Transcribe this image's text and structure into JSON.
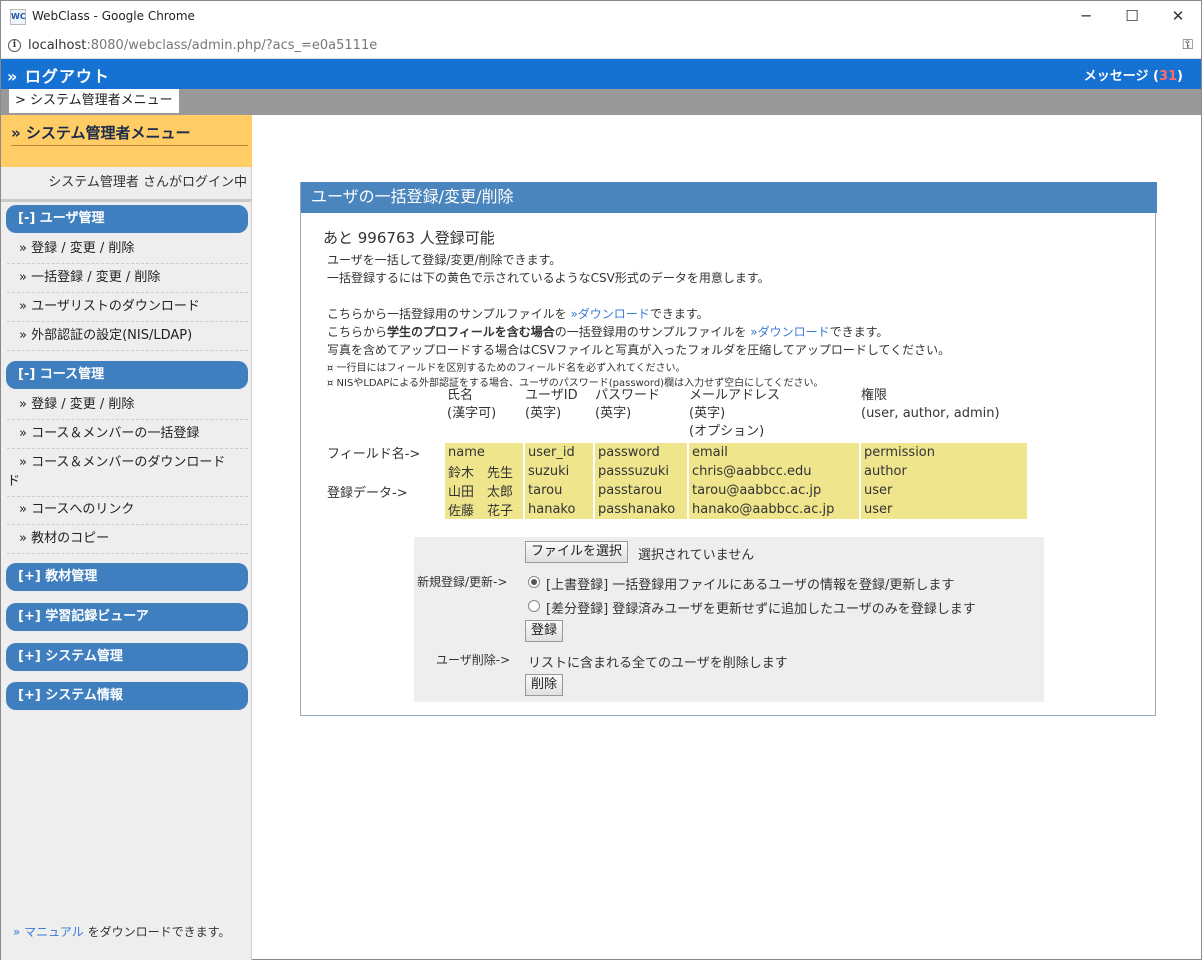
{
  "window": {
    "title": "WebClass - Google Chrome",
    "favicon_text": "WC",
    "minimize": "─",
    "maximize": "☐",
    "close": "✕"
  },
  "address": {
    "host": "localhost",
    "rest": ":8080/webclass/admin.php/?acs_=e0a5111e"
  },
  "topbar": {
    "logout": "» ログアウト",
    "messages_label": "メッセージ (",
    "messages_count": "31",
    "messages_close": ")"
  },
  "breadcrumb": "> システム管理者メニュー",
  "sidebar": {
    "heading": "» システム管理者メニュー",
    "login_user": "システム管理者 さんがログイン中",
    "sections": [
      {
        "label": "[-] ユーザ管理"
      },
      {
        "label": "[-] コース管理"
      },
      {
        "label": "[+] 教材管理"
      },
      {
        "label": "[+] 学習記録ビューア"
      },
      {
        "label": "[+] システム管理"
      },
      {
        "label": "[+] システム情報"
      }
    ],
    "user_items": [
      "» 登録 / 変更 / 削除",
      "» 一括登録 / 変更 / 削除",
      "» ユーザリストのダウンロード",
      "» 外部認証の設定(NIS/LDAP)"
    ],
    "course_items": [
      "» 登録 / 変更 / 削除",
      "» コース＆メンバーの一括登録",
      "» コース＆メンバーのダウンロード",
      "ド",
      "» コースへのリンク",
      "» 教材のコピー"
    ],
    "manual_link": "» マニュアル",
    "manual_text": " をダウンロードできます。"
  },
  "panel": {
    "title": "ユーザの一括登録/変更/削除",
    "remaining": "あと 996763 人登録可能",
    "desc1": "ユーザを一括して登録/変更/削除できます。",
    "desc2": "一括登録するには下の黄色で示されているようなCSV形式のデータを用意します。",
    "sample1_pre": "こちらから一括登録用のサンプルファイルを ",
    "sample1_link": "»ダウンロード",
    "sample1_post": "できます。",
    "sample2_pre": "こちらから",
    "sample2_bold": "学生のプロフィールを含む場合",
    "sample2_mid": "の一括登録用のサンプルファイルを ",
    "sample2_link": "»ダウンロード",
    "sample2_post": "できます。",
    "photo_note": "写真を含めてアップロードする場合はCSVファイルと写真が入ったフォルダを圧縮してアップロードしてください。",
    "note1": "¤ 一行目にはフィールドを区別するためのフィールド名を必ず入れてください。",
    "note2": "¤ NISやLDAPによる外部認証をする場合、ユーザのパスワード(password)欄は入力せず空白にしてください。",
    "columns": [
      {
        "line1": "氏名",
        "line2": "(漢字可)",
        "line3": ""
      },
      {
        "line1": "ユーザID",
        "line2": "(英字)",
        "line3": ""
      },
      {
        "line1": "パスワード",
        "line2": "(英字)",
        "line3": ""
      },
      {
        "line1": "メールアドレス",
        "line2": "(英字)",
        "line3": "(オプション)"
      },
      {
        "line1": "権限",
        "line2": "(user, author, admin)",
        "line3": ""
      }
    ],
    "field_label": "フィールド名->",
    "data_label": "登録データ->",
    "rows": [
      [
        "name",
        "user_id",
        "password",
        "email",
        "permission"
      ],
      [
        "鈴木　先生",
        "suzuki",
        "passsuzuki",
        "chris@aabbcc.edu",
        "author"
      ],
      [
        "山田　太郎",
        "tarou",
        "passtarou",
        "tarou@aabbcc.ac.jp",
        "user"
      ],
      [
        "佐藤　花子",
        "hanako",
        "passhanako",
        "hanako@aabbcc.ac.jp",
        "user"
      ]
    ],
    "form": {
      "file_button": "ファイルを選択",
      "file_status": "選択されていません",
      "new_label": "新規登録/更新->",
      "opt_overwrite": "[上書登録] 一括登録用ファイルにあるユーザの情報を登録/更新します",
      "opt_diff": "[差分登録] 登録済みユーザを更新せずに追加したユーザのみを登録します",
      "register_button": "登録",
      "delete_label": "ユーザ削除->",
      "delete_desc": "リストに含まれる全てのユーザを削除します",
      "delete_button": "削除"
    }
  }
}
